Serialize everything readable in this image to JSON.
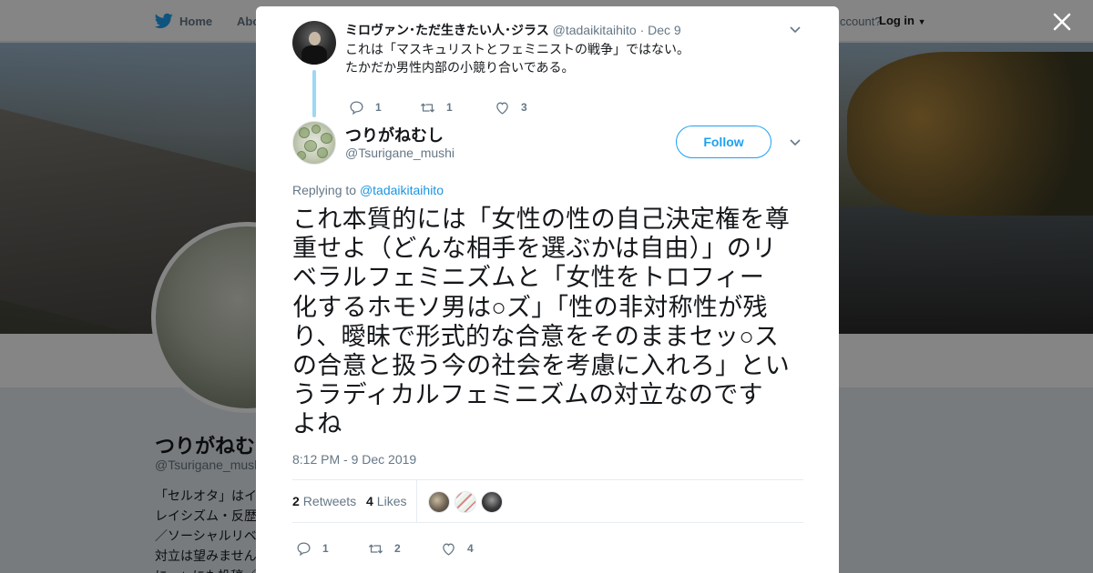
{
  "background": {
    "nav": {
      "home": "Home",
      "about": "Abo",
      "account_question": "ccount?",
      "login": "Log in"
    },
    "profile": {
      "name": "つりがねむし",
      "handle": "@Tsurigane_mushi",
      "bio_lines": [
        "「セルオタ」はイ",
        "レイシズム・反歴",
        "／ソーシャルリベ",
        "対立は望みません",
        "にnoteにも投稿／"
      ]
    }
  },
  "modal": {
    "ancestor": {
      "name": "ミロヴァン･ただ生きたい人･ジラス",
      "handle": "@tadaikitaihito",
      "separator": "·",
      "date": "Dec 9",
      "text_lines": [
        "これは「マスキュリストとフェミニストの戦争」ではない。",
        "たかだか男性内部の小競り合いである。"
      ],
      "replies": "1",
      "retweets": "1",
      "likes": "3"
    },
    "tweet": {
      "name": "つりがねむし",
      "handle": "@Tsurigane_mushi",
      "follow_label": "Follow",
      "replying_prefix": "Replying to ",
      "replying_mention": "@tadaikitaihito",
      "text_lines": [
        "これ本質的には「女性の性の自己決定権を尊",
        "重せよ（どんな相手を選ぶかは自由）」のリ",
        "ベラルフェミニズムと「女性をトロフィー",
        "化するホモソ男は○ズ」「性の非対称性が残",
        "り、曖昧で形式的な合意をそのままセッ○ス",
        "の合意と扱う今の社会を考慮に入れろ」とい",
        "うラディカルフェミニズムの対立なのです",
        "よね"
      ],
      "timestamp": "8:12 PM - 9 Dec 2019",
      "retweets_count": "2",
      "retweets_label": "Retweets",
      "likes_count": "4",
      "likes_label": "Likes",
      "replies": "1",
      "retweets": "2",
      "likes": "4"
    }
  },
  "colors": {
    "accent": "#1da1f2",
    "link": "#1b95e0",
    "muted": "#657786",
    "thread": "#9fd6f3"
  }
}
